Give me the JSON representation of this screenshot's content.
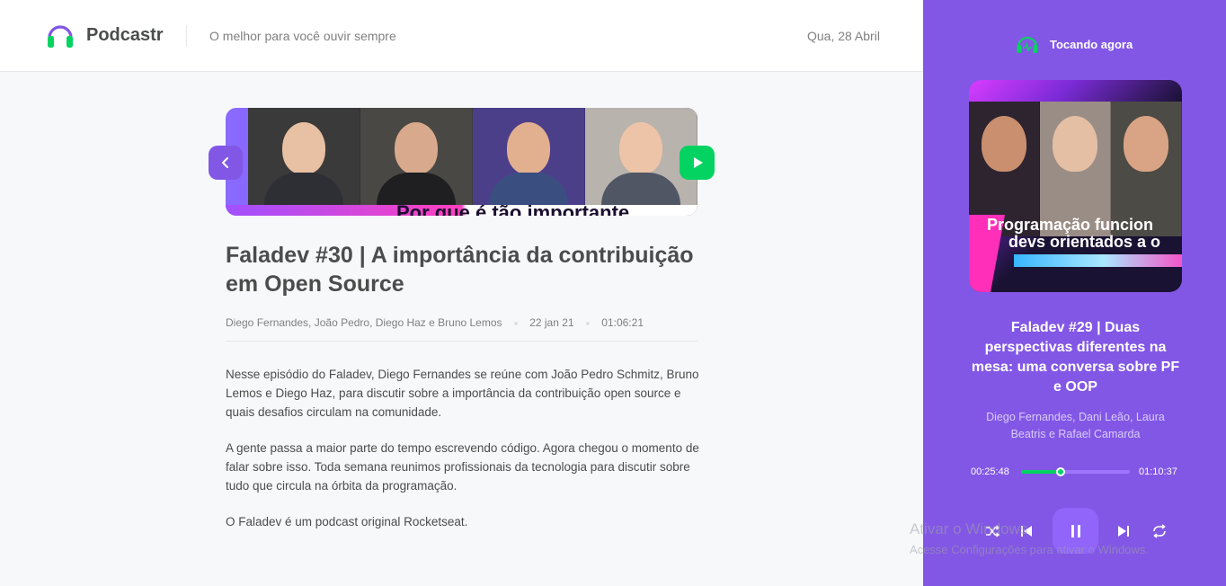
{
  "header": {
    "app_name": "Podcastr",
    "tagline": "O melhor para você ouvir sempre",
    "date": "Qua, 28 Abril",
    "icon": "headphones-icon"
  },
  "episode": {
    "title": "Faladev #30 | A importância da contribuição em Open Source",
    "thumbnail_caption": "Por que é tão importante",
    "members": "Diego Fernandes, João Pedro, Diego Haz e Bruno Lemos",
    "published_at": "22 jan 21",
    "duration": "01:06:21",
    "description": [
      "Nesse episódio do Faladev, Diego Fernandes se reúne com João Pedro Schmitz, Bruno Lemos e Diego Haz, para discutir sobre a importância da contribuição open source e quais desafios circulam na comunidade.",
      "A gente passa a maior parte do tempo escrevendo código. Agora chegou o momento de falar sobre isso. Toda semana reunimos profissionais da tecnologia para discutir sobre tudo que circula na órbita da programação.",
      "O Faladev é um podcast original Rocketseat."
    ]
  },
  "player": {
    "label": "Tocando agora",
    "cover_caption_line1": "Programação funcion",
    "cover_caption_line2": "devs orientados a o",
    "title": "Faladev #29 | Duas perspectivas diferentes na mesa: uma conversa sobre PF e OOP",
    "members": "Diego Fernandes, Dani Leão, Laura Beatris e Rafael Camarda",
    "current_time": "00:25:48",
    "total_time": "01:10:37",
    "progress": 0.365,
    "colors": {
      "panel": "#8257e5",
      "accent": "#04d361"
    }
  },
  "watermark": {
    "line1": "Ativar o Windows",
    "line2": "Acesse Configurações para ativar o Windows."
  }
}
